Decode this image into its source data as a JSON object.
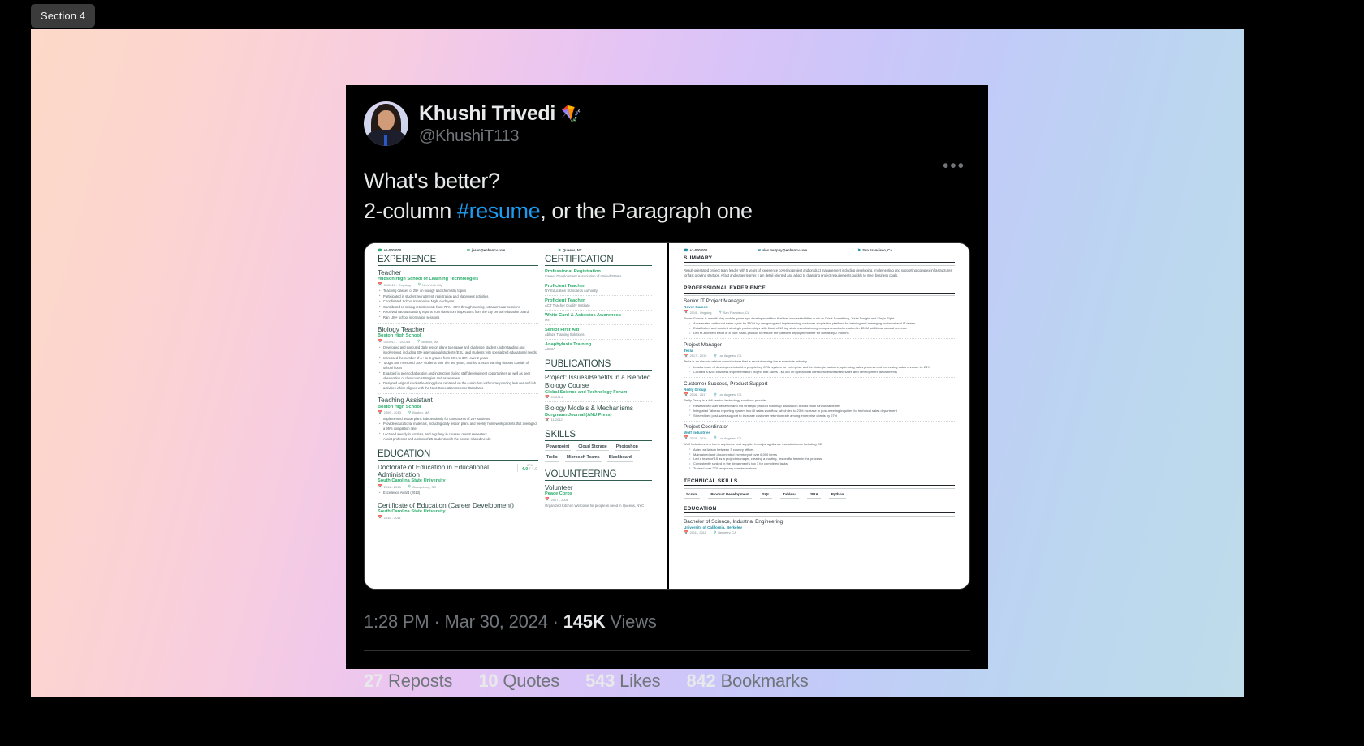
{
  "section_tag": "Section 4",
  "tweet": {
    "display_name": "Khushi Trivedi",
    "badge_icon": "kite-emoji",
    "badge_glyph": "🪁",
    "handle": "@KhushiT113",
    "more_icon": "•••",
    "text_line1": "What's better?",
    "text_line2_a": "2-column ",
    "text_hashtag": "#resume",
    "text_line2_b": ", or the Paragraph one",
    "timestamp": "1:28 PM",
    "date": "Mar 30, 2024",
    "views_count": "145K",
    "views_label": "Views",
    "meta_sep": " · ",
    "stats": [
      {
        "count": "27",
        "label": "Reposts"
      },
      {
        "count": "10",
        "label": "Quotes"
      },
      {
        "count": "543",
        "label": "Likes"
      },
      {
        "count": "842",
        "label": "Bookmarks"
      }
    ],
    "accent_color": "#1d9bf0"
  },
  "resume_left": {
    "accent_color": "#2bab6a",
    "contacts": [
      {
        "icon": "phone-icon",
        "glyph": "☎",
        "text": "+1-000-000"
      },
      {
        "icon": "email-icon",
        "glyph": "✉",
        "text": "jason@enhancv.com"
      },
      {
        "icon": "location-icon",
        "glyph": "⚑",
        "text": "Queens, NY"
      }
    ],
    "sections": {
      "experience_title": "EXPERIENCE",
      "education_title": "EDUCATION",
      "certification_title": "CERTIFICATION",
      "publications_title": "PUBLICATIONS",
      "skills_title": "SKILLS",
      "volunteering_title": "VOLUNTEERING"
    },
    "experience": [
      {
        "title": "Teacher",
        "org": "Hudson High School of Learning Technologies",
        "dates": "01/2015 - Ongoing",
        "location": "New York City",
        "bullets": [
          "Teaching classes of 25+ on biology and chemistry topics",
          "Participated in student recruitment, registration and placement activities",
          "Coordinated School Information Night each year",
          "Contributed to raising retention rate from 75% - 89% through running extracurricular sessions",
          "Received two outstanding reports from classroom inspections from the city central education board",
          "Ran 100+ school information sessions"
        ]
      },
      {
        "title": "Biology Teacher",
        "org": "Boston High School",
        "dates": "01/2013 - 12/2015",
        "location": "Boston, MA",
        "bullets": [
          "Developed and executed daily lesson plans to engage and challenge student understanding and involvement, including 30+ international students (ESL) and students with specialized educational needs",
          "Increased the number of A+ to C grades from 60% to 80% over 2 years",
          "Taught and mentored 100+ students over the two years, and led 5 extra learning classes outside of school hours",
          "Engaged in peer collaboration and instruction during staff development opportunities as well as peer observation of classroom strategies and assessmen",
          "Designed original student learning plans centered on the curriculum with corresponding lectures and lab activities which aligned with the Next Generation Science Standards"
        ]
      },
      {
        "title": "Teaching Assistant",
        "org": "Boston High School",
        "dates": "2009 - 2013",
        "location": "Boston, MA",
        "bullets": [
          "Implemented lesson plans independently for classrooms of 25+ students",
          "Provide educational materials, including daily lesson plans and weekly homework packets that averaged a 95% completion rate",
          "Lectured weekly in tutorials, and regularly in courses over 8 semesters",
          "Assist professor and a class of 25 students with the course related needs"
        ]
      }
    ],
    "education": [
      {
        "degree": "Doctorate of Education in Educational Administration",
        "school": "South Carolina State University",
        "dates": "2011 - 2013",
        "location": "Orangeburg, SC",
        "gpa_label": "GPA",
        "gpa_value": "4.0",
        "gpa_max": "/ 4.0",
        "bullets": [
          "Excellence Award (2013)"
        ]
      },
      {
        "degree": "Certificate of Education (Career Development)",
        "school": "South Carolina State University",
        "dates": "2010 - 2011",
        "location": "",
        "gpa_label": "",
        "gpa_value": "",
        "gpa_max": "",
        "bullets": []
      }
    ],
    "certifications": [
      {
        "title": "Professional Registration",
        "issuer": "Career Development Association of United States"
      },
      {
        "title": "Proficient Teacher",
        "issuer": "NY Education Standards Authority"
      },
      {
        "title": "Proficient Teacher",
        "issuer": "ACT Teacher Quality Institute"
      },
      {
        "title": "White Card & Asbestos Awareness",
        "issuer": "MIT"
      },
      {
        "title": "Senior First Aid",
        "issuer": "Ablaze Training Solutions"
      },
      {
        "title": "Anaphylaxis Training",
        "issuer": "ACSIA"
      }
    ],
    "publications": [
      {
        "title": "Project: Issues/Benefits in a Blended Biology Course",
        "publisher": "Global Science and Technology Forum",
        "date": "09/2014"
      },
      {
        "title": "Biology Models & Mechanisms",
        "publisher": "Burgmann Journal (ANU Press)",
        "date": "11/2012"
      }
    ],
    "skills": [
      "Powerpoint",
      "Cloud Storage",
      "Photoshop",
      "Trello",
      "Microsoft Teams",
      "Blackboard"
    ],
    "volunteering": [
      {
        "role": "Volunteer",
        "org": "Peace Corps",
        "dates": "2007 - 2008",
        "desc": "Organized Kitchen Welcome for people in need in Queens, NYC"
      }
    ]
  },
  "resume_right": {
    "accent_color": "#1f8ea3",
    "contacts": [
      {
        "icon": "phone-icon",
        "glyph": "☎",
        "text": "+1-000-000"
      },
      {
        "icon": "email-icon",
        "glyph": "✉",
        "text": "alex.murphy@enhancv.com"
      },
      {
        "icon": "location-icon",
        "glyph": "⚑",
        "text": "San Francisco, CA"
      }
    ],
    "sections": {
      "summary_title": "SUMMARY",
      "experience_title": "PROFESSIONAL EXPERIENCE",
      "skills_title": "TECHNICAL SKILLS",
      "education_title": "EDUCATION"
    },
    "summary": "Result-orientated project team leader with 5 years of experience covering project and product management including developing, implementing and supporting complex infrastructures for fast growing startups. A fast and eager learner, I am detail oriented and adopt to changing project requirements quickly to meet business goals.",
    "experience": [
      {
        "title": "Senior IT Project Manager",
        "org": "Rover Games",
        "dates": "2019 - Ongoing",
        "location": "San Francisco, CA",
        "desc": "Rover Games is a multi-play mobile game app development firm that has successful titles such as Drink Something, Trivia Tonight and King's Fight",
        "bullets": [
          "Accelerated outbound sales cycle by 330% by designing and implementing customer acquisition platform for training and managing technical and IT teams",
          "Established and curated strategic partnerships with 6 out of 10 top state manufacturing companies which resulted in $20M additional annual revenue",
          "Led re-architect effort of a core SaaS product to reduce the platform deployment time for clients by 2 months"
        ]
      },
      {
        "title": "Project Manager",
        "org": "Tesla",
        "dates": "2017 - 2019",
        "location": "Los Angeles, CA",
        "desc": "Tesla is an electric vehicle manufacturer that is revolutionizing the automobile industry",
        "bullets": [
          "Lead a team of developers to build a proprietary CRM system for enterprise and its strategic partners, optimizing sales process and increasing sales revenue by 24%",
          "Curated a $2M business implementation project that saves - $3.5M on operational inefficiencies between sales and development departments"
        ]
      },
      {
        "title": "Customer Success, Product Support",
        "org": "Reilly Group",
        "dates": "2016 - 2017",
        "location": "Los Angeles, CA",
        "desc": "Reilly Group is a full service technology solutions provider",
        "bullets": [
          "Researched user behavior and led strategic product roadmap discussion across multi functional teams",
          "Integrated Tableau reporting system into BI sales workflow, which led to 23% increase in post-meeting inquiries for technical sales department",
          "Streamlined post-sales support to increase customer retention rate among enterprise clients by 27%"
        ]
      },
      {
        "title": "Project Coordinator",
        "org": "Wolf Industries",
        "dates": "2015 - 2016",
        "location": "Los Angeles, CA",
        "desc": "Wolf Industries is a home appliance part supplier to major appliance manufacturers including GE",
        "bullets": [
          "Acted as liaison between 3 country offices",
          "Maintained and documented inventory of over 6,000 items",
          "Led a team of 15 as a project manager, creating a trusting, respectful team in the process",
          "Consistently ranked in the department's top 3 for completed tasks",
          "Trained over 270 temporary remote workers"
        ]
      }
    ],
    "skills": [
      "Scrum",
      "Product Development",
      "SQL",
      "Tableau",
      "JIRA",
      "Python"
    ],
    "education": [
      {
        "degree": "Bachelor of Science, Industrial Engineering",
        "school": "University of California, Berkeley",
        "dates": "2011 - 2015",
        "location": "Berkeley, CA"
      }
    ]
  }
}
